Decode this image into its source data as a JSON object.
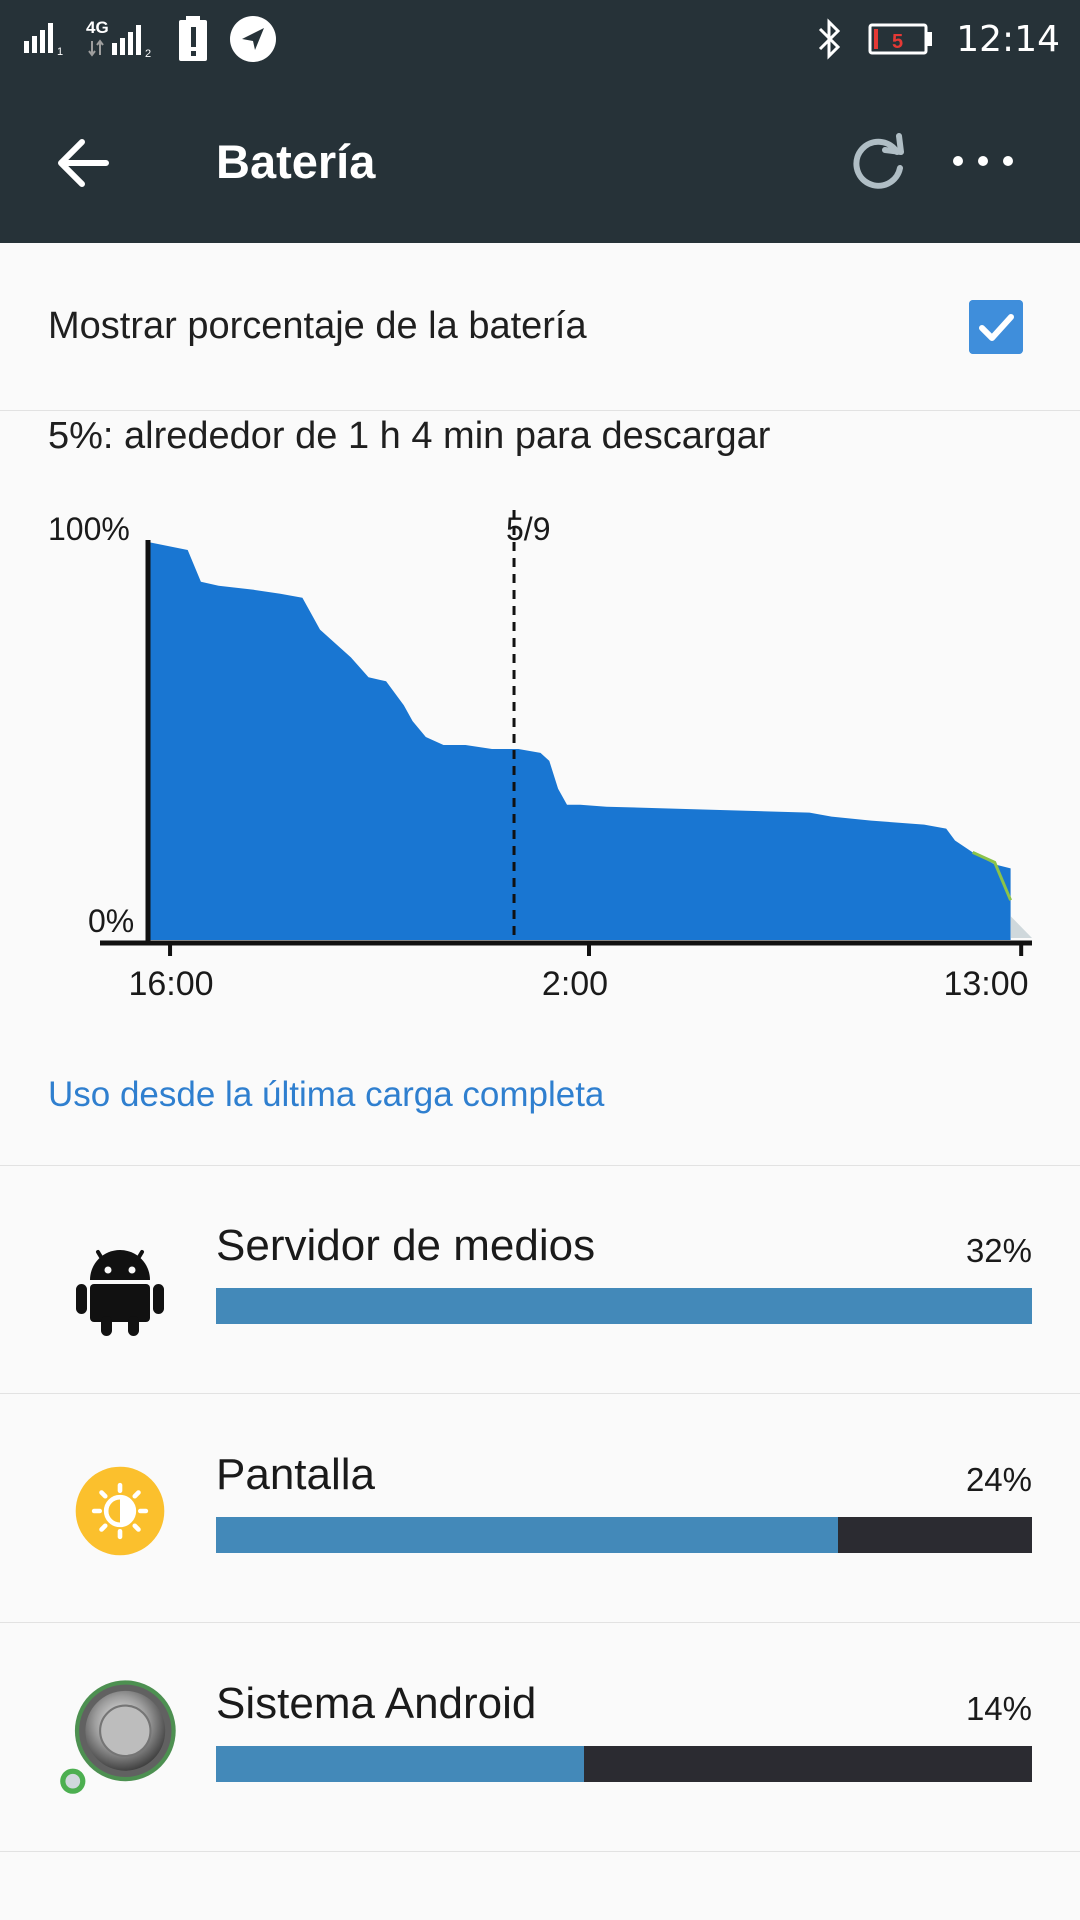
{
  "status_bar": {
    "network_label": "4G",
    "sim1_index": "1",
    "sim2_index": "2",
    "battery_level": "5",
    "time": "12:14"
  },
  "app_bar": {
    "title": "Batería"
  },
  "settings": {
    "show_percentage_label": "Mostrar porcentaje de la batería",
    "show_percentage_checked": true
  },
  "estimate_text": "5%: alrededor de 1 h 4 min para descargar",
  "chart_data": {
    "type": "area",
    "y_axis_labels": [
      "100%",
      "0%"
    ],
    "ylim": [
      0,
      100
    ],
    "x_tick_labels": [
      "16:00",
      "2:00",
      "13:00"
    ],
    "date_marker_label": "5/9",
    "colors": {
      "fill": "#1976d2",
      "charging": "#8bc34a",
      "prediction": "#cfd8dc"
    },
    "series": [
      {
        "values_time_fraction": [
          0,
          0.045,
          0.06,
          0.08,
          0.12,
          0.15,
          0.175,
          0.185,
          0.195,
          0.21,
          0.23,
          0.25,
          0.27,
          0.29,
          0.3,
          0.315,
          0.335,
          0.36,
          0.39,
          0.42,
          0.445,
          0.455,
          0.465,
          0.475,
          0.49,
          0.52,
          0.6,
          0.75,
          0.775,
          0.82,
          0.88,
          0.905,
          0.915,
          0.935,
          0.96,
          0.978
        ],
        "values_percent": [
          100,
          98,
          90,
          89,
          88,
          87,
          86,
          82,
          78,
          75,
          71,
          66,
          65,
          59,
          55,
          51,
          49,
          49,
          48,
          48,
          47,
          45,
          38,
          34,
          34,
          33.5,
          33,
          32,
          31,
          30,
          29,
          28,
          25,
          22,
          19,
          18
        ]
      }
    ],
    "marker_time_fraction": 0.415,
    "tick_time_fractions": [
      0.025,
      0.5,
      0.99
    ]
  },
  "usage_link": "Uso desde la última carga completa",
  "apps": [
    {
      "name": "Servidor de medios",
      "percent_label": "32%",
      "bar_fraction": 1.0,
      "icon": "android-icon"
    },
    {
      "name": "Pantalla",
      "percent_label": "24%",
      "bar_fraction": 0.762,
      "icon": "brightness-icon"
    },
    {
      "name": "Sistema Android",
      "percent_label": "14%",
      "bar_fraction": 0.451,
      "icon": "system-knob-icon"
    }
  ]
}
